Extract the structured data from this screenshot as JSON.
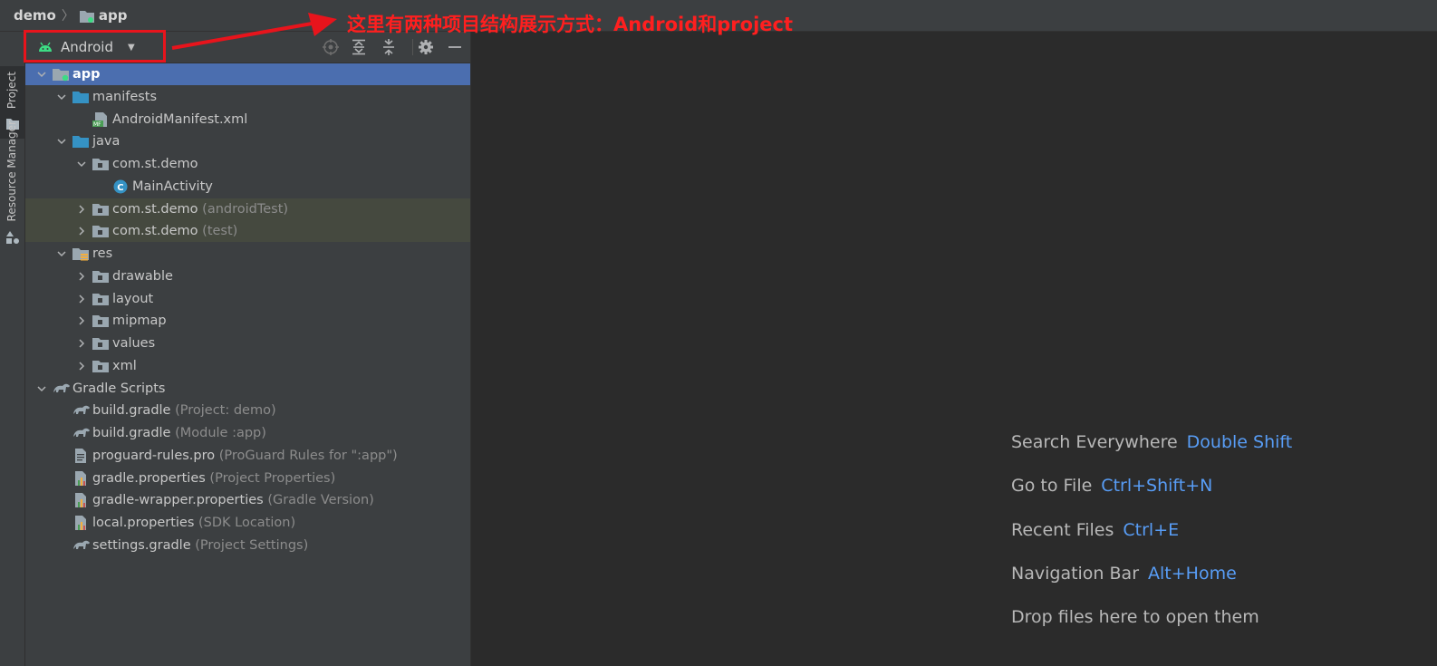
{
  "breadcrumb": {
    "root": "demo",
    "module": "app"
  },
  "annotation": {
    "text": "这里有两种项目结构展示方式：Android和project",
    "color": "#ff1f1f"
  },
  "side_tabs": {
    "project": "Project",
    "resource_manager": "Resource Manager"
  },
  "panel": {
    "view_mode": "Android",
    "toolbar_icons": [
      "locate-icon",
      "expand-all-icon",
      "collapse-all-icon",
      "gear-icon",
      "hide-icon"
    ]
  },
  "tree": [
    {
      "label": "app",
      "hint": "",
      "chevron": "down",
      "icon": "module-icon",
      "selected": true
    },
    {
      "label": "manifests",
      "hint": "",
      "chevron": "down",
      "icon": "folder-icon"
    },
    {
      "label": "AndroidManifest.xml",
      "hint": "",
      "chevron": "",
      "icon": "manifest-icon"
    },
    {
      "label": "java",
      "hint": "",
      "chevron": "down",
      "icon": "folder-icon"
    },
    {
      "label": "com.st.demo",
      "hint": "",
      "chevron": "down",
      "icon": "package-icon"
    },
    {
      "label": "MainActivity",
      "hint": "",
      "chevron": "",
      "icon": "class-icon"
    },
    {
      "label": "com.st.demo",
      "hint": "(androidTest)",
      "chevron": "right",
      "icon": "package-icon",
      "test": true
    },
    {
      "label": "com.st.demo",
      "hint": "(test)",
      "chevron": "right",
      "icon": "package-icon",
      "test": true
    },
    {
      "label": "res",
      "hint": "",
      "chevron": "down",
      "icon": "res-folder-icon"
    },
    {
      "label": "drawable",
      "hint": "",
      "chevron": "right",
      "icon": "package-icon"
    },
    {
      "label": "layout",
      "hint": "",
      "chevron": "right",
      "icon": "package-icon"
    },
    {
      "label": "mipmap",
      "hint": "",
      "chevron": "right",
      "icon": "package-icon"
    },
    {
      "label": "values",
      "hint": "",
      "chevron": "right",
      "icon": "package-icon"
    },
    {
      "label": "xml",
      "hint": "",
      "chevron": "right",
      "icon": "package-icon"
    },
    {
      "label": "Gradle Scripts",
      "hint": "",
      "chevron": "down",
      "icon": "gradle-icon"
    },
    {
      "label": "build.gradle",
      "hint": "(Project: demo)",
      "chevron": "",
      "icon": "gradle-icon"
    },
    {
      "label": "build.gradle",
      "hint": "(Module :app)",
      "chevron": "",
      "icon": "gradle-icon"
    },
    {
      "label": "proguard-rules.pro",
      "hint": "(ProGuard Rules for \":app\")",
      "chevron": "",
      "icon": "text-file-icon"
    },
    {
      "label": "gradle.properties",
      "hint": "(Project Properties)",
      "chevron": "",
      "icon": "properties-icon"
    },
    {
      "label": "gradle-wrapper.properties",
      "hint": "(Gradle Version)",
      "chevron": "",
      "icon": "properties-icon"
    },
    {
      "label": "local.properties",
      "hint": "(SDK Location)",
      "chevron": "",
      "icon": "properties-icon"
    },
    {
      "label": "settings.gradle",
      "hint": "(Project Settings)",
      "chevron": "",
      "icon": "gradle-icon"
    }
  ],
  "shortcuts": [
    {
      "action": "Search Everywhere",
      "key": "Double Shift"
    },
    {
      "action": "Go to File",
      "key": "Ctrl+Shift+N"
    },
    {
      "action": "Recent Files",
      "key": "Ctrl+E"
    },
    {
      "action": "Navigation Bar",
      "key": "Alt+Home"
    },
    {
      "action": "Drop files here to open them",
      "key": ""
    }
  ],
  "colors": {
    "selection": "#4b6eaf",
    "test_bg": "#45493f",
    "shortcut_key": "#589df6",
    "android_green": "#3ddc84",
    "folder": "#3592c4"
  }
}
